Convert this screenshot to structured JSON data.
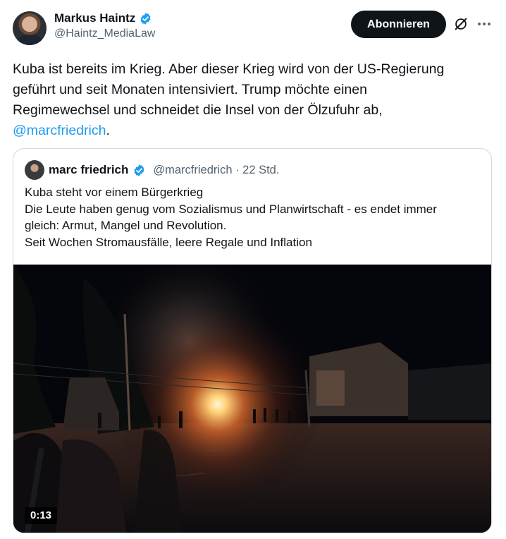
{
  "post": {
    "author_name": "Markus Haintz",
    "author_handle": "@Haintz_MediaLaw",
    "follow_label": "Abonnieren",
    "text_lines": [
      "Kuba ist bereits im Krieg. Aber dieser Krieg wird von der US-Regierung",
      "geführt und seit Monaten intensiviert. Trump möchte einen",
      "Regimewechsel und schneidet die Insel von der Ölzufuhr ab,"
    ],
    "mention": "@marcfriedrich",
    "mention_suffix": "."
  },
  "quote": {
    "author_name": "marc friedrich",
    "author_handle": "@marcfriedrich · 22 Std.",
    "lines": [
      "Kuba steht vor einem Bürgerkrieg",
      "Die Leute haben genug vom Sozialismus und Planwirtschaft - es endet immer",
      "gleich: Armut, Mangel und Revolution.",
      "Seit Wochen Stromausfälle, leere Regale und Inflation"
    ],
    "video_duration": "0:13"
  },
  "colors": {
    "accent": "#1d9bf0",
    "text": "#0f1419",
    "secondary": "#536471",
    "button_bg": "#0f1419"
  },
  "icons": [
    "verified-badge-icon",
    "grok-icon",
    "more-icon"
  ]
}
